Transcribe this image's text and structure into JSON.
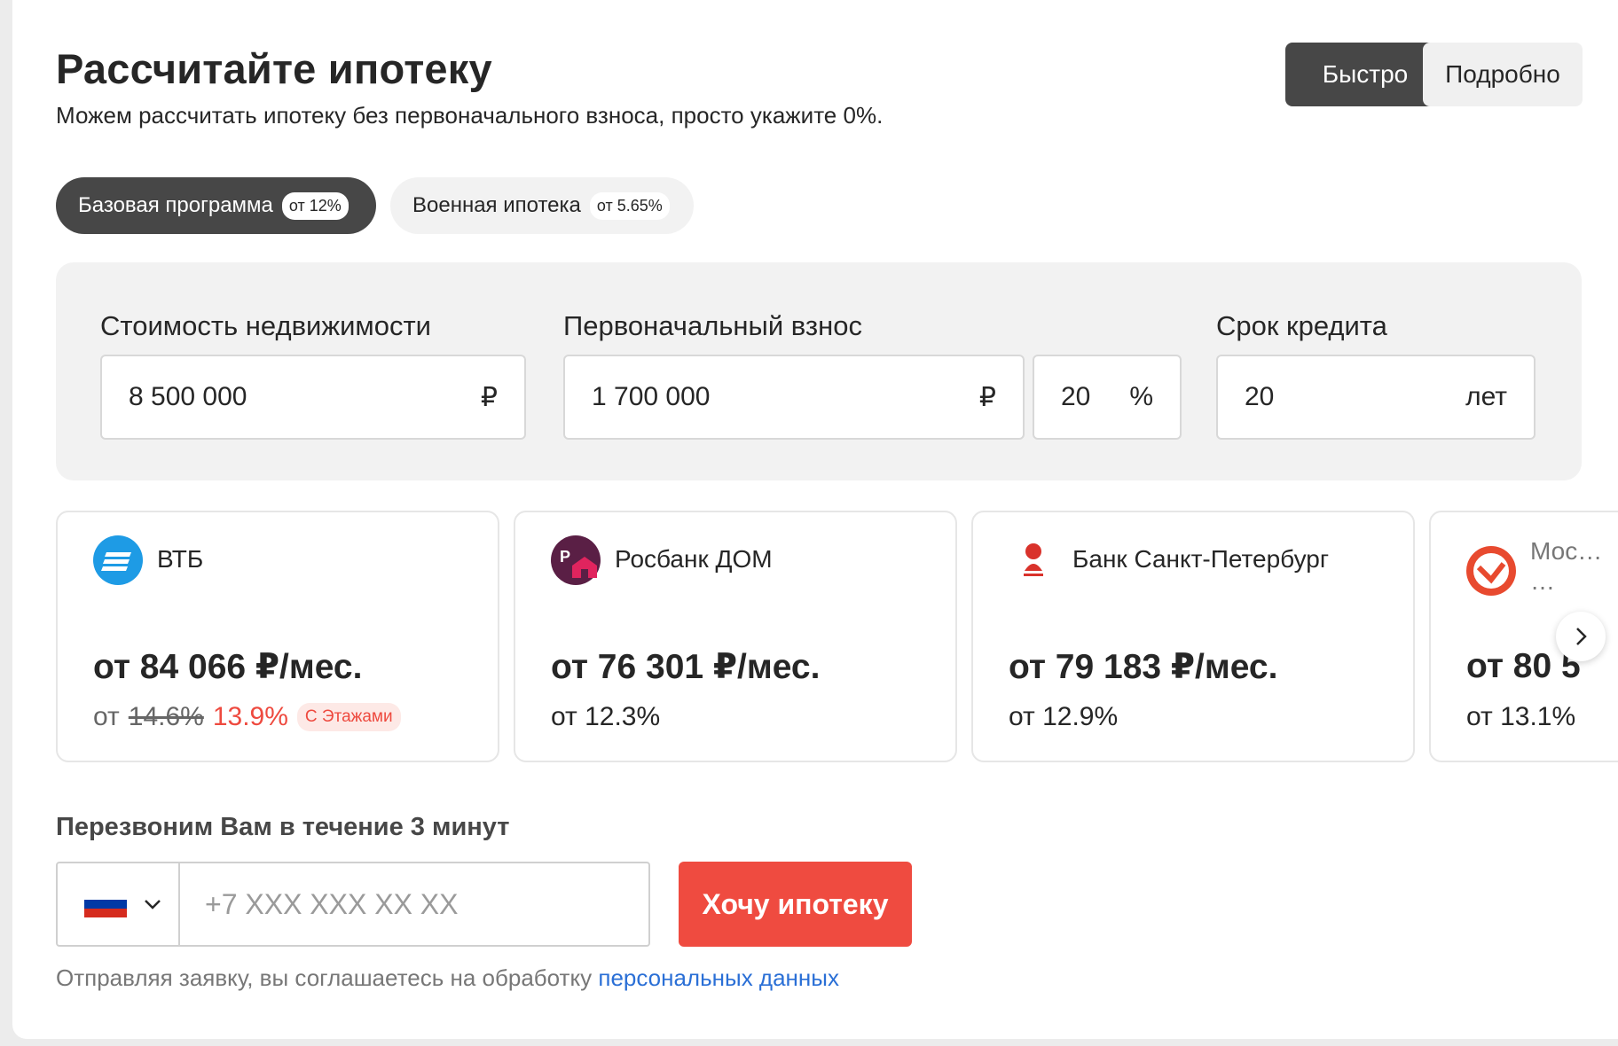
{
  "header": {
    "title": "Рассчитайте ипотеку",
    "subtitle": "Можем рассчитать ипотеку без первоначального взноса, просто укажите 0%.",
    "modes": [
      "Быстро",
      "Подробно"
    ]
  },
  "programs": [
    {
      "label": "Базовая программа",
      "badge": "от 12%"
    },
    {
      "label": "Военная ипотека",
      "badge": "от 5.65%"
    }
  ],
  "calculator": {
    "price_label": "Стоимость недвижимости",
    "price_value": "8 500 000",
    "price_unit": "₽",
    "down_label": "Первоначальный взнос",
    "down_value": "1 700 000",
    "down_unit": "₽",
    "down_percent": "20",
    "percent_unit": "%",
    "term_label": "Срок кредита",
    "term_value": "20",
    "term_unit": "лет"
  },
  "banks": [
    {
      "name": "ВТБ",
      "payment": "от 84 066 ₽/мес.",
      "rate_prefix": "от",
      "rate_old": "14.6%",
      "rate": "13.9%",
      "promo": "С Этажами",
      "logo": "vtb-logo",
      "color": "#1e9be5"
    },
    {
      "name": "Росбанк ДОМ",
      "payment": "от 76 301 ₽/мес.",
      "rate": "от 12.3%",
      "logo": "rosbank-dom-logo",
      "color": "#5a1f45"
    },
    {
      "name": "Банк Санкт-Петербург",
      "payment": "от 79 183 ₽/мес.",
      "rate": "от 12.9%",
      "logo": "bspb-logo",
      "color": "#d9322b"
    },
    {
      "name": "Мос…",
      "name_line2": "…",
      "payment": "от 80 5",
      "rate": "от 13.1%",
      "logo": "moscow-credit-bank-logo",
      "color": "#e84a2f"
    }
  ],
  "callback": {
    "title": "Перезвоним Вам в течение 3 минут",
    "phone_placeholder": "+7 XXX XXX XX XX",
    "submit_label": "Хочу ипотеку",
    "consent_text": "Отправляя заявку, вы соглашаетесь на обработку ",
    "consent_link": "персональных данных"
  },
  "icons": {
    "next": "chevron-right-icon",
    "dropdown": "chevron-down-icon",
    "flag": "russia-flag-icon"
  }
}
